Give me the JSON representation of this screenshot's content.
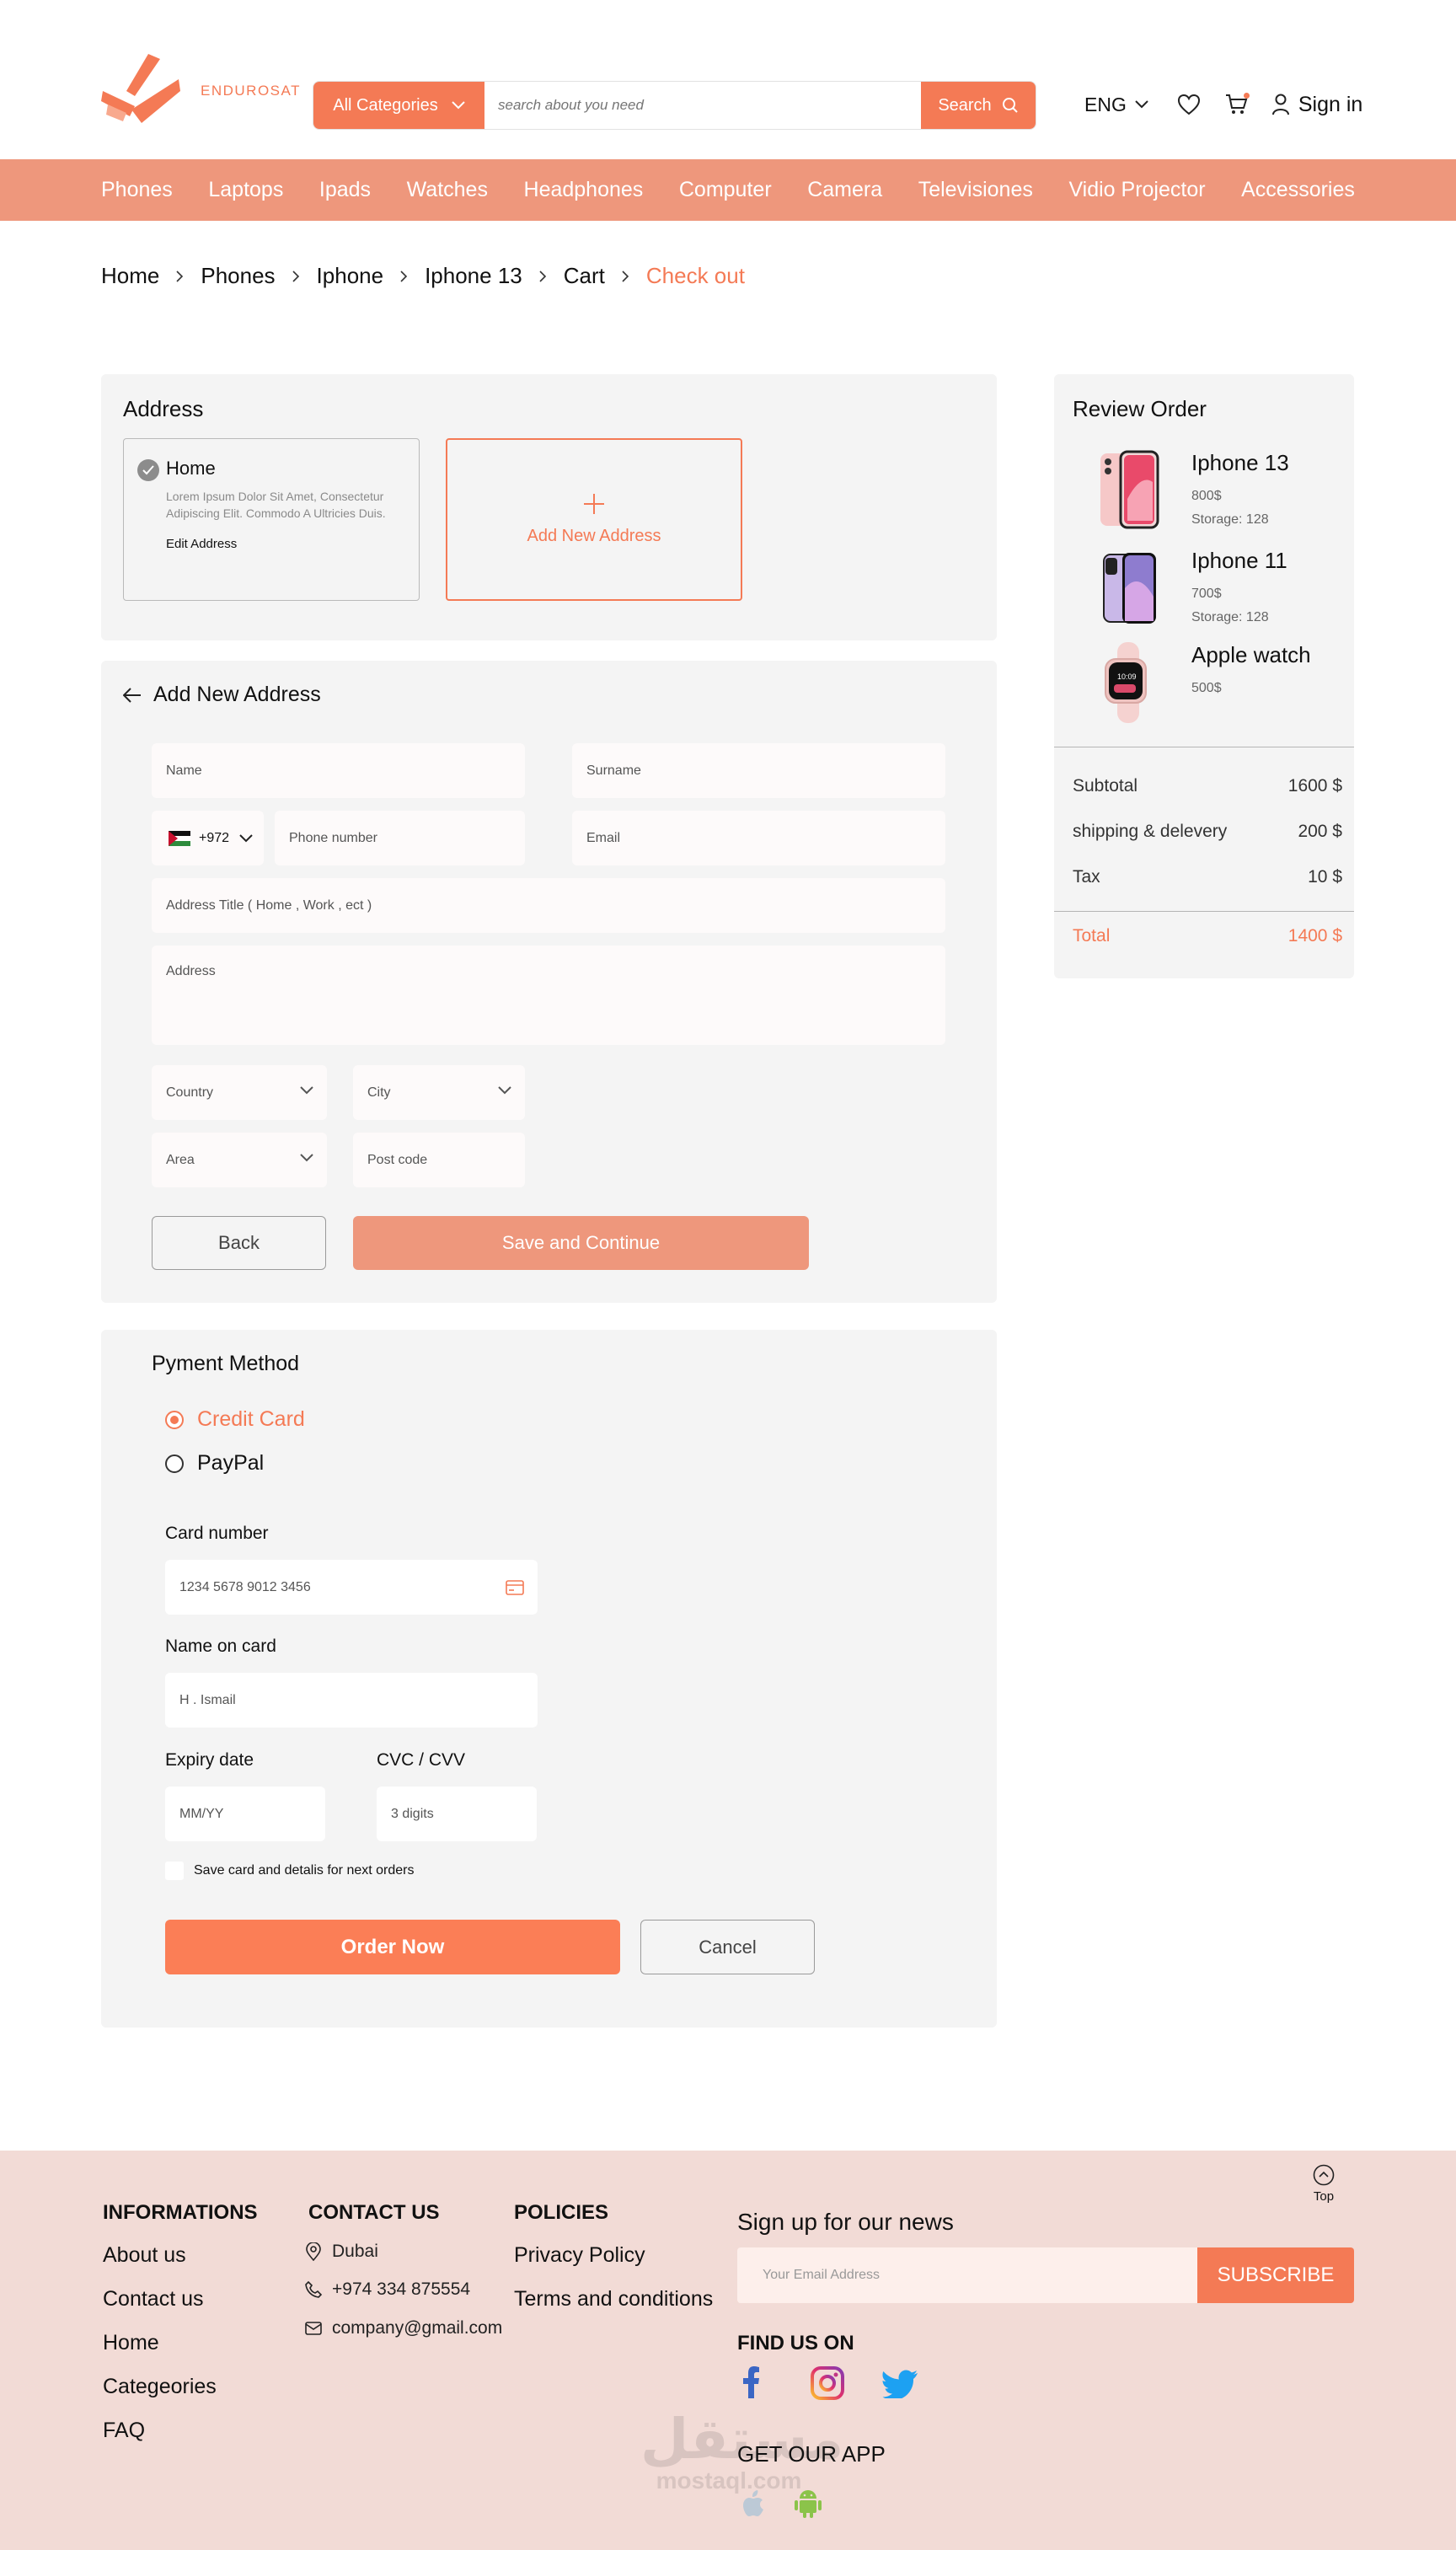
{
  "brand": {
    "name": "ENDUROSAT",
    "accent": "#F47A55",
    "nav_bg": "#EE977C",
    "footer_bg": "#F2DBD6"
  },
  "header": {
    "category_label": "All Categories",
    "search_placeholder": "search about you need",
    "search_label": "Search",
    "language": "ENG",
    "signin_label": "Sign in",
    "icons": [
      "heart-icon",
      "cart-icon",
      "user-icon"
    ]
  },
  "nav": {
    "items": [
      "Phones",
      "Laptops",
      "Ipads",
      "Watches",
      "Headphones",
      "Computer",
      "Camera",
      "Televisiones",
      "Vidio Projector",
      "Accessories"
    ]
  },
  "breadcrumb": {
    "items": [
      "Home",
      "Phones",
      "Iphone",
      "Iphone 13",
      "Cart"
    ],
    "active": "Check out"
  },
  "address": {
    "title": "Address",
    "saved": {
      "name": "Home",
      "description": "Lorem Ipsum Dolor Sit Amet, Consectetur Adipiscing Elit. Commodo A Ultricies Duis.",
      "edit_label": "Edit Address"
    },
    "add_label": "Add New Address"
  },
  "new_address": {
    "title": "Add New Address",
    "name_placeholder": "Name",
    "surname_placeholder": "Surname",
    "phone_code": "+972",
    "phone_placeholder": "Phone number",
    "email_placeholder": "Email",
    "title_placeholder": "Address Title ( Home , Work , ect )",
    "address_placeholder": "Address",
    "country_placeholder": "Country",
    "city_placeholder": "City",
    "area_placeholder": "Area",
    "postcode_placeholder": "Post code",
    "back_label": "Back",
    "save_label": "Save and Continue"
  },
  "payment": {
    "title": "Pyment Method",
    "options": [
      {
        "label": "Credit Card",
        "selected": true
      },
      {
        "label": "PayPal",
        "selected": false
      }
    ],
    "card_number_label": "Card number",
    "card_number_placeholder": "1234  5678  9012  3456",
    "name_label": "Name on card",
    "name_placeholder": "H . Ismail",
    "expiry_label": "Expiry date",
    "expiry_placeholder": "MM/YY",
    "cvc_label": "CVC / CVV",
    "cvc_placeholder": "3 digits",
    "save_card_label": "Save card and detalis for next orders",
    "order_label": "Order Now",
    "cancel_label": "Cancel"
  },
  "review": {
    "title": "Review Order",
    "items": [
      {
        "name": "Iphone 13",
        "price": "800$",
        "storage": "Storage: 128"
      },
      {
        "name": "Iphone 11",
        "price": "700$",
        "storage": "Storage: 128"
      },
      {
        "name": "Apple watch",
        "price": "500$"
      }
    ],
    "summary": [
      {
        "label": "Subtotal",
        "value": "1600 $"
      },
      {
        "label": "shipping & delevery",
        "value": "200 $"
      },
      {
        "label": "Tax",
        "value": "10 $"
      }
    ],
    "total": {
      "label": "Total",
      "value": "1400 $"
    }
  },
  "footer": {
    "informations": {
      "title": "INFORMATIONS",
      "links": [
        "About us",
        "Contact us",
        "Home",
        "Categeories",
        "FAQ"
      ]
    },
    "contact": {
      "title": "CONTACT US",
      "city": "Dubai",
      "phone": "+974 334 875554",
      "email": "company@gmail.com"
    },
    "policies": {
      "title": "POLICIES",
      "links": [
        "Privacy Policy",
        "Terms and conditions"
      ]
    },
    "newsletter": {
      "title": "Sign up for our news",
      "placeholder": "Your Email Address",
      "button": "SUBSCRIBE"
    },
    "find_us": "FIND US ON",
    "get_app": "GET OUR APP",
    "top_label": "Top"
  },
  "watermark": {
    "arabic": "مستقل",
    "latin": "mostaql.com"
  }
}
